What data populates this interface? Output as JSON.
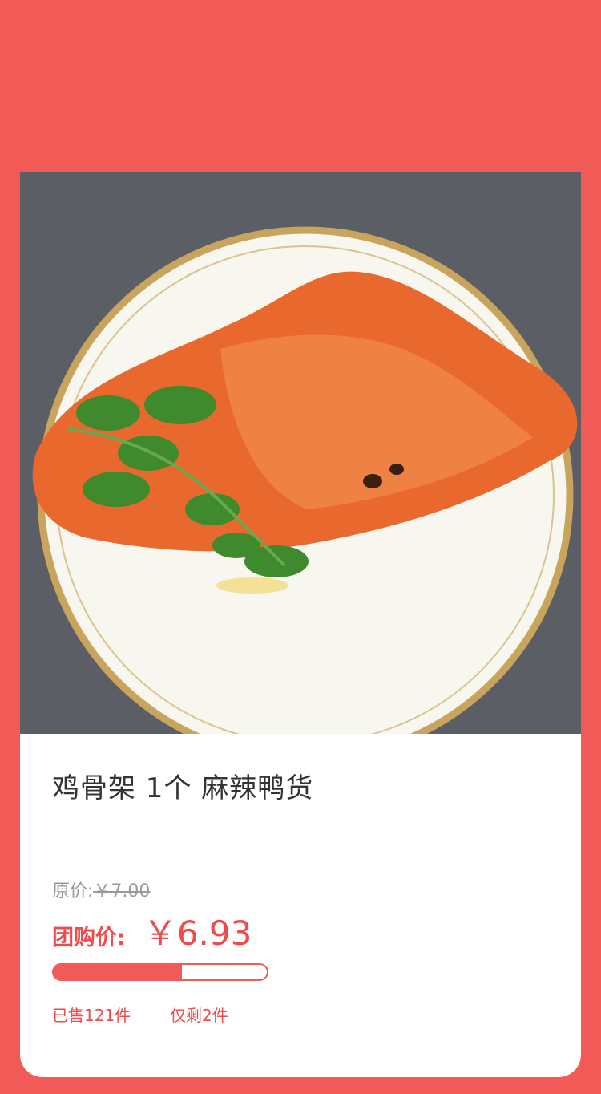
{
  "product": {
    "title": "鸡骨架 1个 麻辣鸭货",
    "image_alt": "food-photo"
  },
  "pricing": {
    "original_label": "原价:",
    "original_price": "￥7.00",
    "group_label": "团购价:",
    "group_price": "￥6.93"
  },
  "sales": {
    "progress_fraction": 0.6,
    "sold_text": "已售121件",
    "remaining_text": "仅剩2件"
  },
  "colors": {
    "background": "#f25a57",
    "accent": "#f24a4a"
  }
}
